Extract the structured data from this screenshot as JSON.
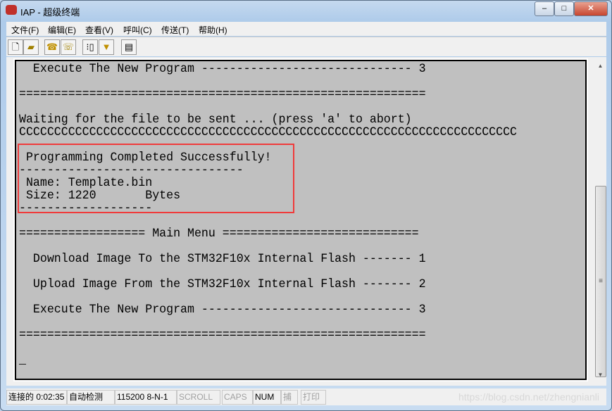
{
  "window": {
    "title": "IAP - 超级终端"
  },
  "menu": [
    "文件(F)",
    "编辑(E)",
    "查看(V)",
    "呼叫(C)",
    "传送(T)",
    "帮助(H)"
  ],
  "toolbar": [
    "new-icon",
    "open-icon",
    "call-icon",
    "disconnect-icon",
    "send-icon",
    "receive-icon",
    "properties-icon"
  ],
  "terminal": {
    "lines": [
      "  Execute The New Program ------------------------------ 3",
      "",
      "==========================================================",
      "",
      "Waiting for the file to be sent ... (press 'a' to abort)",
      "CCCCCCCCCCCCCCCCCCCCCCCCCCCCCCCCCCCCCCCCCCCCCCCCCCCCCCCCCCCCCCCCCCCCCCC",
      "",
      " Programming Completed Successfully!",
      "--------------------------------",
      " Name: Template.bin",
      " Size: 1220       Bytes",
      "-------------------",
      "",
      "================== Main Menu ============================",
      "",
      "  Download Image To the STM32F10x Internal Flash ------- 1",
      "",
      "  Upload Image From the STM32F10x Internal Flash ------- 2",
      "",
      "  Execute The New Program ------------------------------ 3",
      "",
      "==========================================================",
      "",
      "_"
    ],
    "highlight_color": "#f03a3a"
  },
  "status": {
    "connected": "连接的 0:02:35",
    "detect": "自动检测",
    "port": "115200 8-N-1",
    "scroll": "SCROLL",
    "caps": "CAPS",
    "num": "NUM",
    "capture": "捕",
    "print": "打印"
  },
  "watermark": "https://blog.csdn.net/zhengnianli"
}
